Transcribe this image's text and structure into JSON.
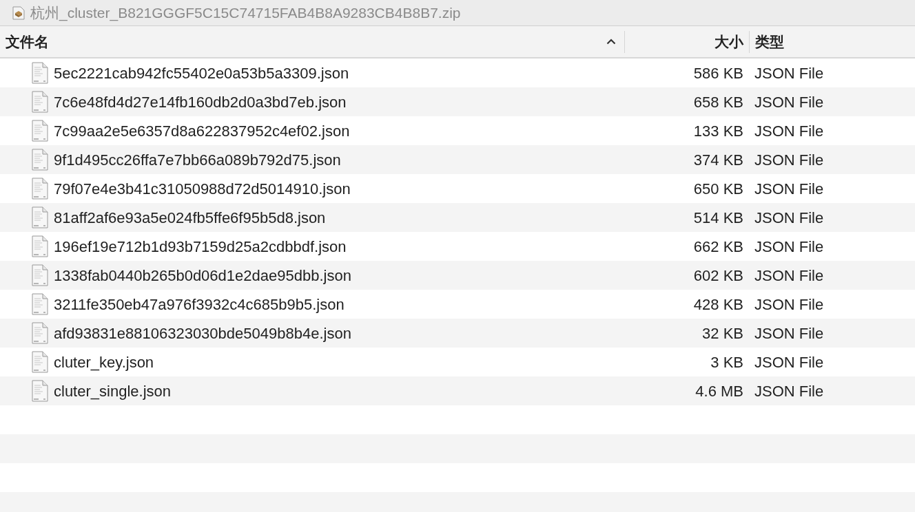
{
  "window": {
    "title": "杭州_cluster_B821GGGF5C15C74715FAB4B8A9283CB4B8B7.zip"
  },
  "table": {
    "columns": [
      {
        "label": "文件名",
        "sorted": true
      },
      {
        "label": "大小",
        "sorted": false
      },
      {
        "label": "类型",
        "sorted": false
      }
    ],
    "rows": [
      {
        "name": "5ec2221cab942fc55402e0a53b5a3309.json",
        "size": "586 KB",
        "type": "JSON File"
      },
      {
        "name": "7c6e48fd4d27e14fb160db2d0a3bd7eb.json",
        "size": "658 KB",
        "type": "JSON File"
      },
      {
        "name": "7c99aa2e5e6357d8a622837952c4ef02.json",
        "size": "133 KB",
        "type": "JSON File"
      },
      {
        "name": "9f1d495cc26ffa7e7bb66a089b792d75.json",
        "size": "374 KB",
        "type": "JSON File"
      },
      {
        "name": "79f07e4e3b41c31050988d72d5014910.json",
        "size": "650 KB",
        "type": "JSON File"
      },
      {
        "name": "81aff2af6e93a5e024fb5ffe6f95b5d8.json",
        "size": "514 KB",
        "type": "JSON File"
      },
      {
        "name": "196ef19e712b1d93b7159d25a2cdbbdf.json",
        "size": "662 KB",
        "type": "JSON File"
      },
      {
        "name": "1338fab0440b265b0d06d1e2dae95dbb.json",
        "size": "602 KB",
        "type": "JSON File"
      },
      {
        "name": "3211fe350eb47a976f3932c4c685b9b5.json",
        "size": "428 KB",
        "type": "JSON File"
      },
      {
        "name": "afd93831e88106323030bde5049b8b4e.json",
        "size": "32 KB",
        "type": "JSON File"
      },
      {
        "name": "cluter_key.json",
        "size": "3 KB",
        "type": "JSON File"
      },
      {
        "name": "cluter_single.json",
        "size": "4.6 MB",
        "type": "JSON File"
      }
    ]
  }
}
